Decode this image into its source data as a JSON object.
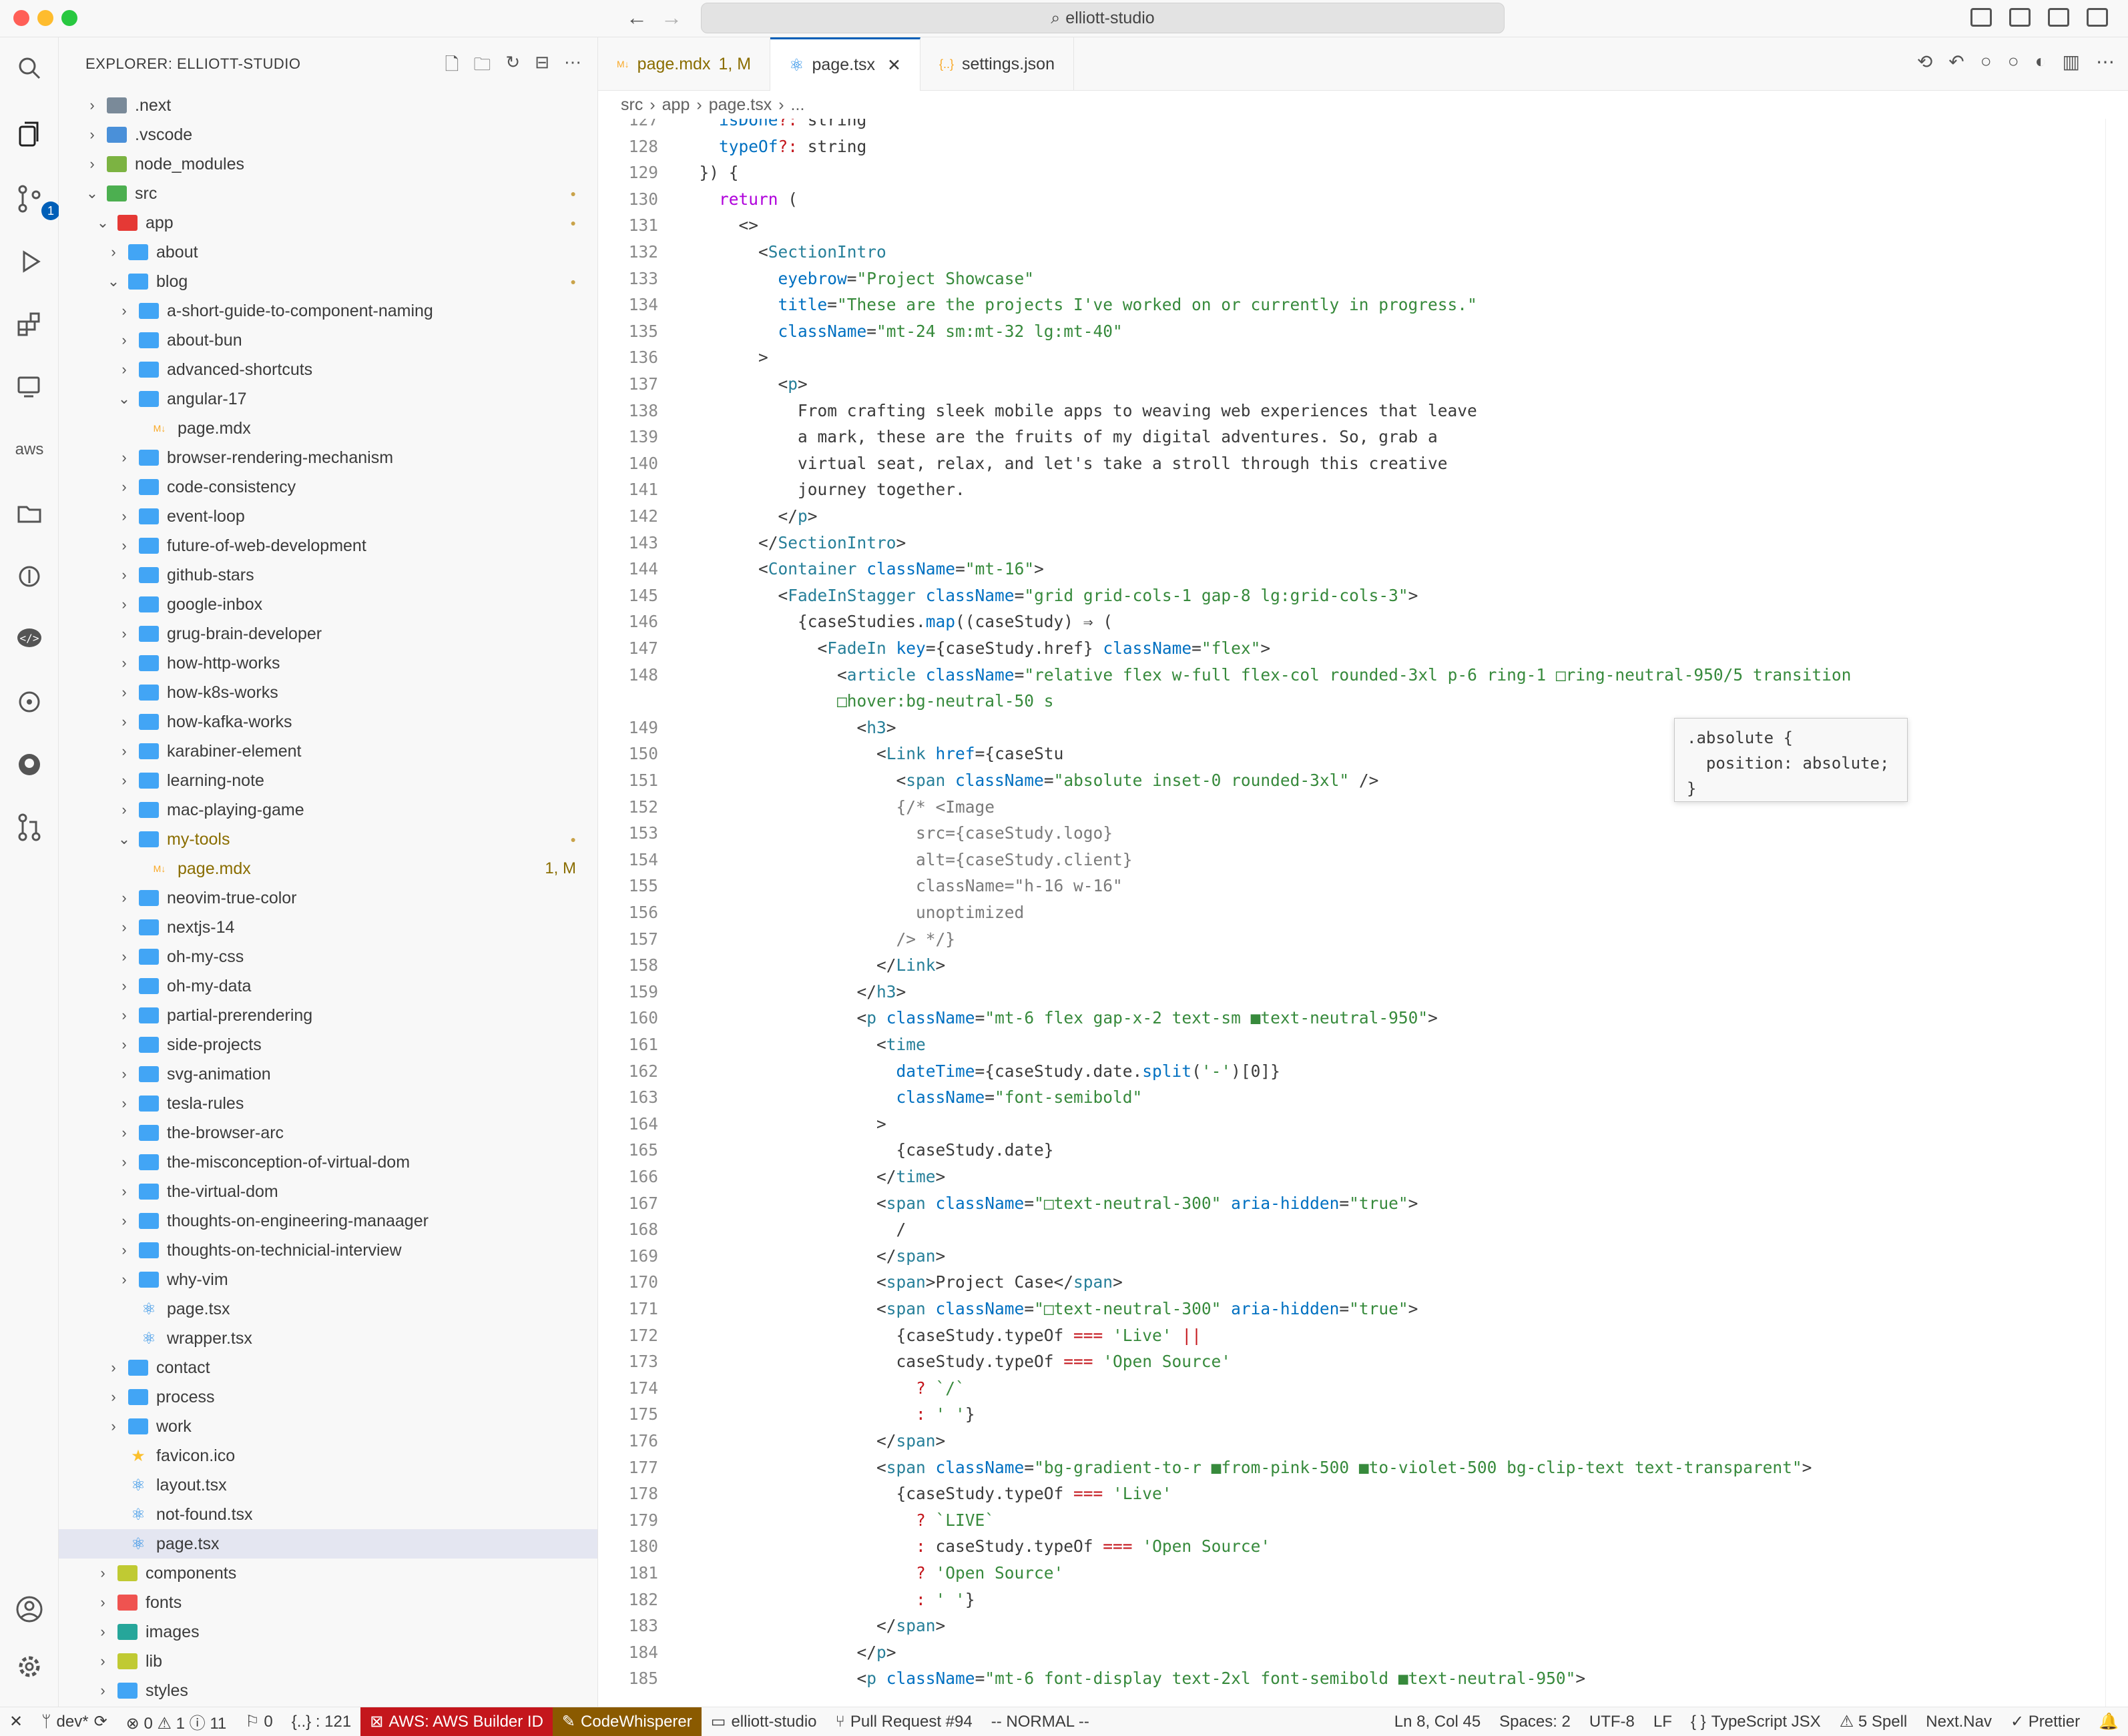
{
  "window": {
    "title": "elliott-studio"
  },
  "colors": {
    "accent": "#005fb8",
    "aws": "#c4161c",
    "codewhisperer": "#8a5a00",
    "modified": "#b8860b",
    "bg": "#f8f8f8"
  },
  "sidebar": {
    "title": "EXPLORER: ELLIOTT-STUDIO",
    "actions": [
      "new-file-icon",
      "new-folder-icon",
      "refresh-icon",
      "collapse-icon",
      "more-icon"
    ],
    "tree": [
      {
        "label": ".next",
        "depth": 0,
        "type": "folder",
        "open": false,
        "color": "#7a8a99"
      },
      {
        "label": ".vscode",
        "depth": 0,
        "type": "folder",
        "open": false,
        "color": "#4a90d9"
      },
      {
        "label": "node_modules",
        "depth": 0,
        "type": "folder",
        "open": false,
        "color": "#7cb342"
      },
      {
        "label": "src",
        "depth": 0,
        "type": "folder",
        "open": true,
        "color": "#4caf50",
        "deco": "●"
      },
      {
        "label": "app",
        "depth": 1,
        "type": "folder",
        "open": true,
        "color": "#e53935",
        "deco": "●"
      },
      {
        "label": "about",
        "depth": 2,
        "type": "folder",
        "open": false,
        "color": "#42a5f5"
      },
      {
        "label": "blog",
        "depth": 2,
        "type": "folder",
        "open": true,
        "color": "#42a5f5",
        "deco": "●"
      },
      {
        "label": "a-short-guide-to-component-naming",
        "depth": 3,
        "type": "folder",
        "open": false,
        "color": "#42a5f5"
      },
      {
        "label": "about-bun",
        "depth": 3,
        "type": "folder",
        "open": false,
        "color": "#42a5f5"
      },
      {
        "label": "advanced-shortcuts",
        "depth": 3,
        "type": "folder",
        "open": false,
        "color": "#42a5f5"
      },
      {
        "label": "angular-17",
        "depth": 3,
        "type": "folder",
        "open": true,
        "color": "#42a5f5"
      },
      {
        "label": "page.mdx",
        "depth": 4,
        "type": "mdx"
      },
      {
        "label": "browser-rendering-mechanism",
        "depth": 3,
        "type": "folder",
        "open": false,
        "color": "#42a5f5"
      },
      {
        "label": "code-consistency",
        "depth": 3,
        "type": "folder",
        "open": false,
        "color": "#42a5f5"
      },
      {
        "label": "event-loop",
        "depth": 3,
        "type": "folder",
        "open": false,
        "color": "#42a5f5"
      },
      {
        "label": "future-of-web-development",
        "depth": 3,
        "type": "folder",
        "open": false,
        "color": "#42a5f5"
      },
      {
        "label": "github-stars",
        "depth": 3,
        "type": "folder",
        "open": false,
        "color": "#42a5f5"
      },
      {
        "label": "google-inbox",
        "depth": 3,
        "type": "folder",
        "open": false,
        "color": "#42a5f5"
      },
      {
        "label": "grug-brain-developer",
        "depth": 3,
        "type": "folder",
        "open": false,
        "color": "#42a5f5"
      },
      {
        "label": "how-http-works",
        "depth": 3,
        "type": "folder",
        "open": false,
        "color": "#42a5f5"
      },
      {
        "label": "how-k8s-works",
        "depth": 3,
        "type": "folder",
        "open": false,
        "color": "#42a5f5"
      },
      {
        "label": "how-kafka-works",
        "depth": 3,
        "type": "folder",
        "open": false,
        "color": "#42a5f5"
      },
      {
        "label": "karabiner-element",
        "depth": 3,
        "type": "folder",
        "open": false,
        "color": "#42a5f5"
      },
      {
        "label": "learning-note",
        "depth": 3,
        "type": "folder",
        "open": false,
        "color": "#42a5f5"
      },
      {
        "label": "mac-playing-game",
        "depth": 3,
        "type": "folder",
        "open": false,
        "color": "#42a5f5"
      },
      {
        "label": "my-tools",
        "depth": 3,
        "type": "folder",
        "open": true,
        "color": "#42a5f5",
        "deco": "●",
        "labelColor": "#8a6d00"
      },
      {
        "label": "page.mdx",
        "depth": 4,
        "type": "mdx",
        "deco": "1, M",
        "labelColor": "#8a6d00"
      },
      {
        "label": "neovim-true-color",
        "depth": 3,
        "type": "folder",
        "open": false,
        "color": "#42a5f5"
      },
      {
        "label": "nextjs-14",
        "depth": 3,
        "type": "folder",
        "open": false,
        "color": "#42a5f5"
      },
      {
        "label": "oh-my-css",
        "depth": 3,
        "type": "folder",
        "open": false,
        "color": "#42a5f5"
      },
      {
        "label": "oh-my-data",
        "depth": 3,
        "type": "folder",
        "open": false,
        "color": "#42a5f5"
      },
      {
        "label": "partial-prerendering",
        "depth": 3,
        "type": "folder",
        "open": false,
        "color": "#42a5f5"
      },
      {
        "label": "side-projects",
        "depth": 3,
        "type": "folder",
        "open": false,
        "color": "#42a5f5"
      },
      {
        "label": "svg-animation",
        "depth": 3,
        "type": "folder",
        "open": false,
        "color": "#42a5f5"
      },
      {
        "label": "tesla-rules",
        "depth": 3,
        "type": "folder",
        "open": false,
        "color": "#42a5f5"
      },
      {
        "label": "the-browser-arc",
        "depth": 3,
        "type": "folder",
        "open": false,
        "color": "#42a5f5"
      },
      {
        "label": "the-misconception-of-virtual-dom",
        "depth": 3,
        "type": "folder",
        "open": false,
        "color": "#42a5f5"
      },
      {
        "label": "the-virtual-dom",
        "depth": 3,
        "type": "folder",
        "open": false,
        "color": "#42a5f5"
      },
      {
        "label": "thoughts-on-engineering-manaager",
        "depth": 3,
        "type": "folder",
        "open": false,
        "color": "#42a5f5"
      },
      {
        "label": "thoughts-on-technicial-interview",
        "depth": 3,
        "type": "folder",
        "open": false,
        "color": "#42a5f5"
      },
      {
        "label": "why-vim",
        "depth": 3,
        "type": "folder",
        "open": false,
        "color": "#42a5f5"
      },
      {
        "label": "page.tsx",
        "depth": 3,
        "type": "tsx"
      },
      {
        "label": "wrapper.tsx",
        "depth": 3,
        "type": "tsx"
      },
      {
        "label": "contact",
        "depth": 2,
        "type": "folder",
        "open": false,
        "color": "#42a5f5"
      },
      {
        "label": "process",
        "depth": 2,
        "type": "folder",
        "open": false,
        "color": "#42a5f5"
      },
      {
        "label": "work",
        "depth": 2,
        "type": "folder",
        "open": false,
        "color": "#42a5f5"
      },
      {
        "label": "favicon.ico",
        "depth": 2,
        "type": "ico"
      },
      {
        "label": "layout.tsx",
        "depth": 2,
        "type": "tsx"
      },
      {
        "label": "not-found.tsx",
        "depth": 2,
        "type": "tsx"
      },
      {
        "label": "page.tsx",
        "depth": 2,
        "type": "tsx",
        "selected": true
      },
      {
        "label": "components",
        "depth": 1,
        "type": "folder",
        "open": false,
        "color": "#c0ca33"
      },
      {
        "label": "fonts",
        "depth": 1,
        "type": "folder",
        "open": false,
        "color": "#ef5350"
      },
      {
        "label": "images",
        "depth": 1,
        "type": "folder",
        "open": false,
        "color": "#26a69a"
      },
      {
        "label": "lib",
        "depth": 1,
        "type": "folder",
        "open": false,
        "color": "#c0ca33"
      },
      {
        "label": "styles",
        "depth": 1,
        "type": "folder",
        "open": false,
        "color": "#42a5f5"
      }
    ]
  },
  "tabs": [
    {
      "label": "page.mdx",
      "deco": "1, M",
      "icon": "mdx-icon",
      "active": false
    },
    {
      "label": "page.tsx",
      "icon": "react-icon",
      "active": true,
      "close": "✕"
    },
    {
      "label": "settings.json",
      "icon": "json-icon",
      "active": false
    }
  ],
  "breadcrumbs": [
    "src",
    "app",
    "page.tsx",
    "..."
  ],
  "code": [
    {
      "n": "127",
      "html": "    <span class='t-attr'>isDone</span><span class='t-op'>?:</span> string"
    },
    {
      "n": "128",
      "html": "    <span class='t-attr'>typeOf</span><span class='t-op'>?:</span> string"
    },
    {
      "n": "129",
      "html": "  }) {"
    },
    {
      "n": "130",
      "html": "    <span class='t-kw'>return</span> ("
    },
    {
      "n": "131",
      "html": "      &lt;&gt;"
    },
    {
      "n": "132",
      "html": "        &lt;<span class='t-tag'>SectionIntro</span>"
    },
    {
      "n": "133",
      "html": "          <span class='t-attr'>eyebrow</span>=<span class='t-str'>\"Project Showcase\"</span>"
    },
    {
      "n": "134",
      "html": "          <span class='t-attr'>title</span>=<span class='t-str'>\"These are the projects I've worked on or currently in progress.\"</span>"
    },
    {
      "n": "135",
      "html": "          <span class='t-attr'>className</span>=<span class='t-str'>\"mt-24 sm:mt-32 lg:mt-40\"</span>"
    },
    {
      "n": "136",
      "html": "        &gt;"
    },
    {
      "n": "137",
      "html": "          &lt;<span class='t-tag'>p</span>&gt;"
    },
    {
      "n": "138",
      "html": "            From crafting sleek mobile apps to weaving web experiences that leave"
    },
    {
      "n": "139",
      "html": "            a mark, these are the fruits of my digital adventures. So, grab a"
    },
    {
      "n": "140",
      "html": "            virtual seat, relax, and let's take a stroll through this creative"
    },
    {
      "n": "141",
      "html": "            journey together."
    },
    {
      "n": "142",
      "html": "          &lt;/<span class='t-tag'>p</span>&gt;"
    },
    {
      "n": "143",
      "html": "        &lt;/<span class='t-tag'>SectionIntro</span>&gt;"
    },
    {
      "n": "144",
      "html": "        &lt;<span class='t-tag'>Container</span> <span class='t-attr'>className</span>=<span class='t-str'>\"mt-16\"</span>&gt;"
    },
    {
      "n": "145",
      "html": "          &lt;<span class='t-tag'>FadeInStagger</span> <span class='t-attr'>className</span>=<span class='t-str'>\"grid grid-cols-1 gap-8 lg:grid-cols-3\"</span>&gt;"
    },
    {
      "n": "146",
      "html": "            {caseStudies.<span class='t-attr'>map</span>((caseStudy) ⇒ ("
    },
    {
      "n": "147",
      "html": "              &lt;<span class='t-tag'>FadeIn</span> <span class='t-attr'>key</span>={caseStudy.href} <span class='t-attr'>className</span>=<span class='t-str'>\"flex\"</span>&gt;"
    },
    {
      "n": "148",
      "html": "                &lt;<span class='t-tag'>article</span> <span class='t-attr'>className</span>=<span class='t-str'>\"relative flex w-full flex-col rounded-3xl p-6 ring-1 □ring-neutral-950/5 transition</span>"
    },
    {
      "n": "",
      "html": "                <span class='t-str'>□hover:bg-neutral-50 s</span>"
    },
    {
      "n": "149",
      "html": "                  &lt;<span class='t-tag'>h3</span>&gt;"
    },
    {
      "n": "150",
      "html": "                    &lt;<span class='t-tag'>Link</span> <span class='t-attr'>href</span>={caseStu"
    },
    {
      "n": "151",
      "html": "                      &lt;<span class='t-tag'>span</span> <span class='t-attr'>className</span>=<span class='t-str'>\"absolute inset-0 rounded-3xl\"</span> /&gt;"
    },
    {
      "n": "152",
      "html": "                      <span class='t-cm'>{/* &lt;Image</span>"
    },
    {
      "n": "153",
      "html": "                        <span class='t-cm'>src={caseStudy.logo}</span>"
    },
    {
      "n": "154",
      "html": "                        <span class='t-cm'>alt={caseStudy.client}</span>"
    },
    {
      "n": "155",
      "html": "                        <span class='t-cm'>className=\"h-16 w-16\"</span>"
    },
    {
      "n": "156",
      "html": "                        <span class='t-cm'>unoptimized</span>"
    },
    {
      "n": "157",
      "html": "                      <span class='t-cm'>/&gt; */}</span>"
    },
    {
      "n": "158",
      "html": "                    &lt;/<span class='t-tag'>Link</span>&gt;"
    },
    {
      "n": "159",
      "html": "                  &lt;/<span class='t-tag'>h3</span>&gt;"
    },
    {
      "n": "160",
      "html": "                  &lt;<span class='t-tag'>p</span> <span class='t-attr'>className</span>=<span class='t-str'>\"mt-6 flex gap-x-2 text-sm ■text-neutral-950\"</span>&gt;"
    },
    {
      "n": "161",
      "html": "                    &lt;<span class='t-tag'>time</span>"
    },
    {
      "n": "162",
      "html": "                      <span class='t-attr'>dateTime</span>={caseStudy.date.<span class='t-attr'>split</span>(<span class='t-str'>'-'</span>)[0]}"
    },
    {
      "n": "163",
      "html": "                      <span class='t-attr'>className</span>=<span class='t-str'>\"font-semibold\"</span>"
    },
    {
      "n": "164",
      "html": "                    &gt;"
    },
    {
      "n": "165",
      "html": "                      {caseStudy.date}"
    },
    {
      "n": "166",
      "html": "                    &lt;/<span class='t-tag'>time</span>&gt;"
    },
    {
      "n": "167",
      "html": "                    &lt;<span class='t-tag'>span</span> <span class='t-attr'>className</span>=<span class='t-str'>\"□text-neutral-300\"</span> <span class='t-attr'>aria-hidden</span>=<span class='t-str'>\"true\"</span>&gt;"
    },
    {
      "n": "168",
      "html": "                      /"
    },
    {
      "n": "169",
      "html": "                    &lt;/<span class='t-tag'>span</span>&gt;"
    },
    {
      "n": "170",
      "html": "                    &lt;<span class='t-tag'>span</span>&gt;Project Case&lt;/<span class='t-tag'>span</span>&gt;"
    },
    {
      "n": "171",
      "html": "                    &lt;<span class='t-tag'>span</span> <span class='t-attr'>className</span>=<span class='t-str'>\"□text-neutral-300\"</span> <span class='t-attr'>aria-hidden</span>=<span class='t-str'>\"true\"</span>&gt;"
    },
    {
      "n": "172",
      "html": "                      {caseStudy.typeOf <span class='t-op'>===</span> <span class='t-str'>'Live'</span> <span class='t-op'>||</span>"
    },
    {
      "n": "173",
      "html": "                      caseStudy.typeOf <span class='t-op'>===</span> <span class='t-str'>'Open Source'</span>"
    },
    {
      "n": "174",
      "html": "                        <span class='t-op'>?</span> <span class='t-str'>`/`</span>"
    },
    {
      "n": "175",
      "html": "                        <span class='t-op'>:</span> <span class='t-str'>' '</span>}"
    },
    {
      "n": "176",
      "html": "                    &lt;/<span class='t-tag'>span</span>&gt;"
    },
    {
      "n": "177",
      "html": "                    &lt;<span class='t-tag'>span</span> <span class='t-attr'>className</span>=<span class='t-str'>\"bg-gradient-to-r ■from-pink-500 ■to-violet-500 bg-clip-text text-transparent\"</span>&gt;"
    },
    {
      "n": "178",
      "html": "                      {caseStudy.typeOf <span class='t-op'>===</span> <span class='t-str'>'Live'</span>"
    },
    {
      "n": "179",
      "html": "                        <span class='t-op'>?</span> <span class='t-str'>`LIVE`</span>"
    },
    {
      "n": "180",
      "html": "                        <span class='t-op'>:</span> caseStudy.typeOf <span class='t-op'>===</span> <span class='t-str'>'Open Source'</span>"
    },
    {
      "n": "181",
      "html": "                        <span class='t-op'>?</span> <span class='t-str'>'Open Source'</span>"
    },
    {
      "n": "182",
      "html": "                        <span class='t-op'>:</span> <span class='t-str'>' '</span>}"
    },
    {
      "n": "183",
      "html": "                    &lt;/<span class='t-tag'>span</span>&gt;"
    },
    {
      "n": "184",
      "html": "                  &lt;/<span class='t-tag'>p</span>&gt;"
    },
    {
      "n": "185",
      "html": "                  &lt;<span class='t-tag'>p</span> <span class='t-attr'>className</span>=<span class='t-str'>\"mt-6 font-display text-2xl font-semibold ■text-neutral-950\"</span>&gt;"
    }
  ],
  "hover": {
    "lines": [
      ".absolute {",
      "  position: absolute;",
      "}"
    ]
  },
  "status": {
    "remote": "✕",
    "branch": "dev*",
    "problems": "⊗ 0 ⚠ 1 ⓘ 11",
    "ports": "⚐ 0",
    "symbols": "{..} : 121",
    "aws": "AWS: AWS Builder ID",
    "codewhisperer": "CodeWhisperer",
    "workspace": "elliott-studio",
    "pr": "Pull Request #94",
    "mode": "-- NORMAL --",
    "position": "Ln 8, Col 45",
    "spaces": "Spaces: 2",
    "encoding": "UTF-8",
    "eol": "LF",
    "language": "TypeScript JSX",
    "spell": "⚠ 5 Spell",
    "nav": "Next.Nav",
    "prettier": "✓ Prettier"
  }
}
